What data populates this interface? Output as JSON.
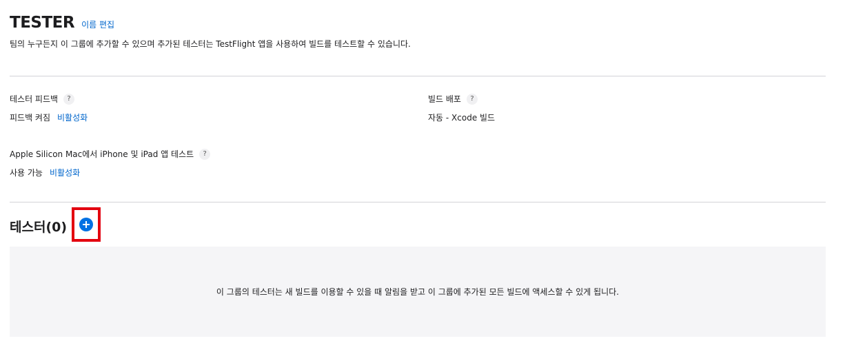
{
  "group": {
    "title": "TESTER",
    "edit_label": "이름 편집",
    "description": "팀의 누구든지 이 그룹에 추가할 수 있으며 추가된 테스터는 TestFlight 앱을 사용하여 빌드를 테스트할 수 있습니다."
  },
  "feedback": {
    "label": "테스터 피드백",
    "help": "?",
    "status": "피드백 켜짐",
    "action": "비활성화"
  },
  "build_distribution": {
    "label": "빌드 배포",
    "help": "?",
    "value": "자동 - Xcode 빌드"
  },
  "apple_silicon": {
    "label": "Apple Silicon Mac에서 iPhone 및 iPad 앱 테스트",
    "help": "?",
    "status": "사용 가능",
    "action": "비활성화"
  },
  "testers": {
    "title": "테스터(0)",
    "add_icon": "plus-circle-icon",
    "empty_message": "이 그룹의 테스터는 새 빌드를 이용할 수 있을 때 알림을 받고 이 그룹에 추가된 모든 빌드에 액세스할 수 있게 됩니다."
  },
  "colors": {
    "link": "#0066cc",
    "accent": "#0071e3",
    "highlight": "#e3000f",
    "panel": "#f5f5f7"
  }
}
